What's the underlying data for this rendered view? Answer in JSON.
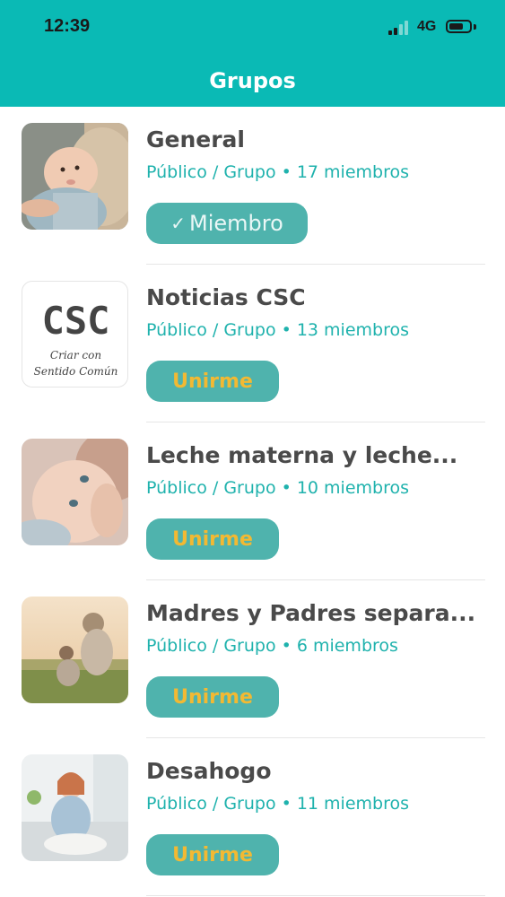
{
  "status_bar": {
    "time": "12:39",
    "network": "4G"
  },
  "header": {
    "title": "Grupos"
  },
  "colors": {
    "header_bg": "#0ABAB5",
    "meta_text": "#1fb2ad",
    "button_bg": "#4fb3ad",
    "join_text": "#f2b933"
  },
  "groups": [
    {
      "name": "General",
      "privacy": "Público / Grupo",
      "members": "17 miembros",
      "button": "Miembro",
      "joined": true,
      "image": "baby-photo"
    },
    {
      "name": "Noticias CSC",
      "privacy": "Público / Grupo",
      "members": "13 miembros",
      "button": "Unirme",
      "joined": false,
      "image": "csc-logo",
      "logo_text": "CSC",
      "logo_sub_1": "Criar con",
      "logo_sub_2": "Sentido Común"
    },
    {
      "name": "Leche materna y leche...",
      "privacy": "Público / Grupo",
      "members": "10 miembros",
      "button": "Unirme",
      "joined": false,
      "image": "breastfeeding-photo"
    },
    {
      "name": "Madres y Padres separa...",
      "privacy": "Público / Grupo",
      "members": "6 miembros",
      "button": "Unirme",
      "joined": false,
      "image": "mother-child-photo"
    },
    {
      "name": "Desahogo",
      "privacy": "Público / Grupo",
      "members": "11 miembros",
      "button": "Unirme",
      "joined": false,
      "image": "stressed-woman-photo"
    }
  ]
}
